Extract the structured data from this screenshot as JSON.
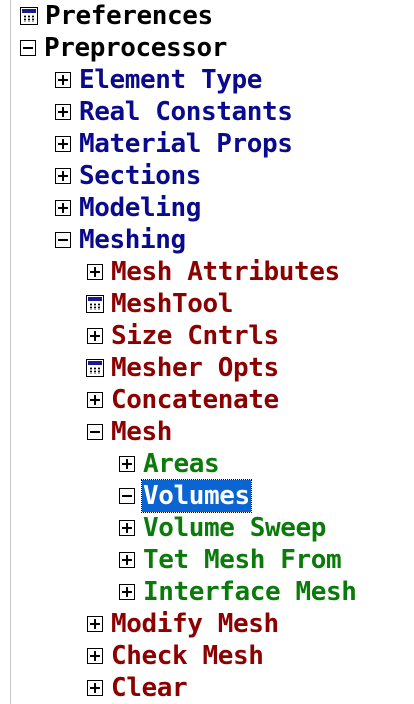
{
  "tree": {
    "preferences": "Preferences",
    "preprocessor": "Preprocessor",
    "element_type": "Element Type",
    "real_constants": "Real Constants",
    "material_props": "Material Props",
    "sections": "Sections",
    "modeling": "Modeling",
    "meshing": "Meshing",
    "mesh_attributes": "Mesh Attributes",
    "meshtool": "MeshTool",
    "size_cntrls": "Size Cntrls",
    "mesher_opts": "Mesher Opts",
    "concatenate": "Concatenate",
    "mesh": "Mesh",
    "areas": "Areas",
    "volumes": "Volumes",
    "volume_sweep": "Volume Sweep",
    "tet_mesh_from": "Tet Mesh From",
    "interface_mesh": "Interface Mesh",
    "modify_mesh": "Modify Mesh",
    "check_mesh": "Check Mesh",
    "clear": "Clear"
  },
  "colors": {
    "top_level": "#000000",
    "preprocessor_children": "#0a0a8c",
    "meshing_children": "#8b0000",
    "mesh_children": "#0a7a0a",
    "selection": "#0a64d2"
  },
  "icons": {
    "calculator": "calculator-icon",
    "expand": "expand-plus-icon",
    "collapse": "collapse-minus-icon"
  },
  "selected_item": "Volumes"
}
